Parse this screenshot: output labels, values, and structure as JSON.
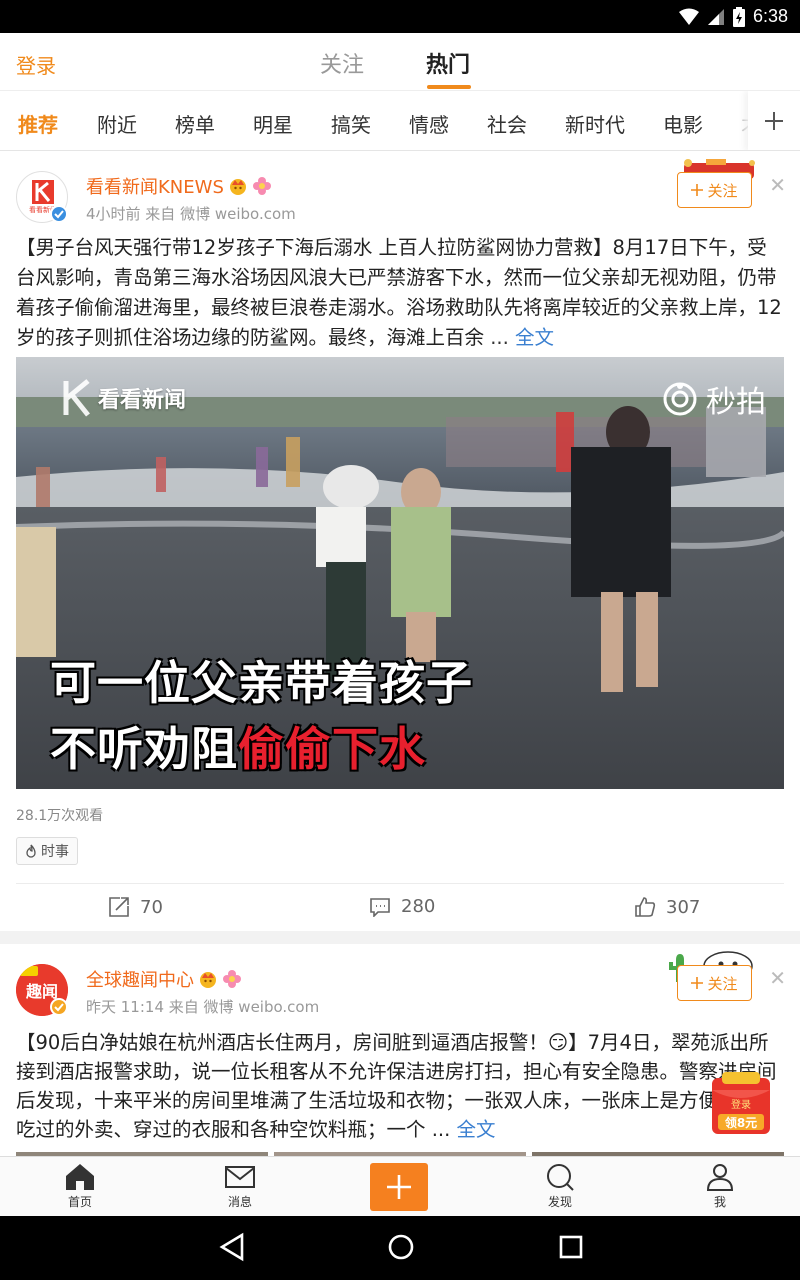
{
  "status_bar": {
    "time": "6:38"
  },
  "top_bar": {
    "login": "登录",
    "tabs": [
      "关注",
      "热门"
    ]
  },
  "channels": [
    "推荐",
    "附近",
    "榜单",
    "明星",
    "搞笑",
    "情感",
    "社会",
    "新时代",
    "电影",
    "才"
  ],
  "post1": {
    "author": "看看新闻KNEWS",
    "meta": "4小时前   来自 微博 weibo.com",
    "follow_label": "关注",
    "text": "【男子台风天强行带12岁孩子下海后溺水 上百人拉防鲨网协力营救】8月17日下午，受台风影响，青岛第三海水浴场因风浪大已严禁游客下水，然而一位父亲却无视劝阻，仍带着孩子偷偷溜进海里，最终被巨浪卷走溺水。浴场救助队先将离岸较近的父亲救上岸，12岁的孩子则抓住浴场边缘的防鲨网。最终，海滩上百余",
    "more": " ...",
    "full": " 全文",
    "video": {
      "watermark": "看看新闻",
      "miaopai": "秒拍",
      "caption_line1": "可一位父亲带着孩子",
      "caption_line2_white": "不听劝阻",
      "caption_line2_red": "偷偷下水"
    },
    "views": "28.1万次观看",
    "topic": "时事",
    "reposts": "70",
    "comments": "280",
    "likes": "307"
  },
  "post2": {
    "author": "全球趣闻中心",
    "avatar_text": "趣闻",
    "meta": "昨天 11:14   来自 微博 weibo.com",
    "follow_label": "关注",
    "text": "【90后白净姑娘在杭州酒店长住两月，房间脏到逼酒店报警！😏】7月4日，翠苑派出所接到酒店报警求助，说一位长租客从不允许保洁进房打扫，担心有安全隐患。警察进房间后发现，十来平米的房间里堆满了生活垃圾和衣物；一张双人床，一张床上是方便面盒、吃过的外卖、穿过的衣服和各种空饮料瓶；一个",
    "more": " ...",
    "full": " 全文"
  },
  "redpack": {
    "line1": "登录",
    "line2": "领8元"
  },
  "bottom_nav": {
    "home": "首页",
    "messages": "消息",
    "discover": "发现",
    "me": "我"
  },
  "colors": {
    "accent": "#f08a1c",
    "link": "#3a7fd0",
    "caption_red": "#e8202e"
  }
}
